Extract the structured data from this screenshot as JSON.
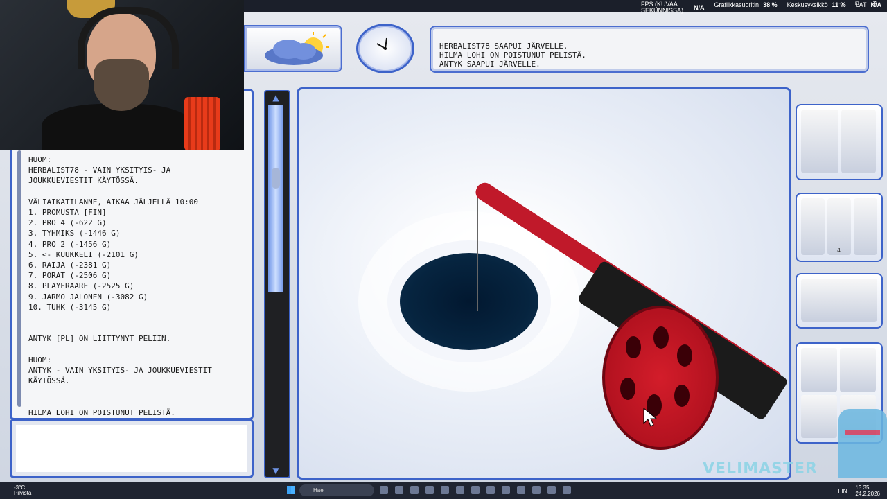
{
  "perf_overlay": {
    "fps_label": "FPS (KUVAA SEKUNNISSA)",
    "fps_value": "N/A",
    "gpu_label": "Grafiikkasuoritin",
    "gpu_value": "38 %",
    "cpu_label": "Keskusyksikkö",
    "cpu_value": "11 %",
    "lat_label": "LAT",
    "lat_value": "N/A"
  },
  "message_bar": {
    "lines": "HERBALIST78 SAAPUI JÄRVELLE.\nHILMA LOHI ON POISTUNUT PELISTÄ.\nANTYK SAAPUI JÄRVELLE."
  },
  "chat": {
    "text": "HUOM:\nHERBALIST78 - VAIN YKSITYIS- JA\nJOUKKUEVIESTIT KÄYTÖSSÄ.\n\nVÄLIAIKATILANNE, AIKAA JÄLJELLÄ 10:00\n1. PROMUSTA [FIN]\n2. PRO 4 (-622 G)\n3. TYHMIKS (-1446 G)\n4. PRO 2 (-1456 G)\n5. <- KUUKKELI (-2101 G)\n6. RAIJA (-2381 G)\n7. PORAT (-2506 G)\n8. PLAYERAARE (-2525 G)\n9. JARMO JALONEN (-3082 G)\n10. TUHK (-3145 G)\n\n\nANTYK [PL] ON LIITTYNYT PELIIN.\n\nHUOM:\nANTYK - VAIN YKSITYIS- JA JOUKKUEVIESTIT\nKÄYTÖSSÄ.\n\n\nHILMA LOHI ON POISTUNUT PELISTÄ."
  },
  "chat_input": {
    "value": ""
  },
  "tool_slots": {
    "count_label": "4"
  },
  "watermark": "VELIMASTER",
  "taskbar": {
    "temp": "-3°C",
    "weather": "Pilvistä",
    "search_placeholder": "Hae",
    "lang": "FIN",
    "time": "13.35",
    "date": "24.2.2026"
  },
  "colors": {
    "frame": "#3d63c9",
    "rod": "#c0192a",
    "ice": "#eef2fa"
  }
}
